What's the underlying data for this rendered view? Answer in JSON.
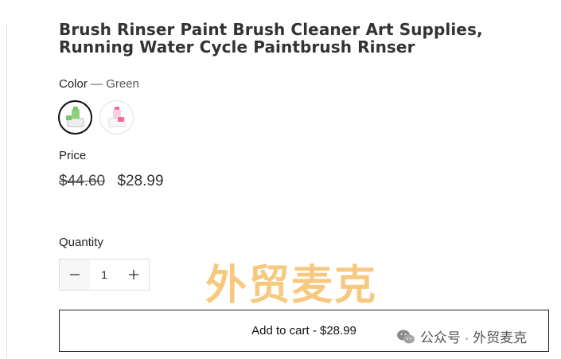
{
  "product": {
    "title": "Brush Rinser Paint Brush Cleaner Art Supplies, Running Water Cycle Paintbrush Rinser",
    "color_label": "Color",
    "color_separator": "—",
    "color_value": "Green",
    "swatches": [
      {
        "name": "Green",
        "selected": true,
        "accent": "#7cc36a"
      },
      {
        "name": "Pink",
        "selected": false,
        "accent": "#f06aa0"
      }
    ],
    "price_label": "Price",
    "price_old": "$44.60",
    "price_new": "$28.99",
    "quantity_label": "Quantity",
    "quantity_value": "1",
    "add_to_cart_label": "Add to cart - $28.99"
  },
  "overlay": {
    "watermark_text": "外贸麦克",
    "wechat_text": "公众号 · 外贸麦克"
  },
  "colors": {
    "watermark": "#f3b44d",
    "border": "#222222"
  }
}
